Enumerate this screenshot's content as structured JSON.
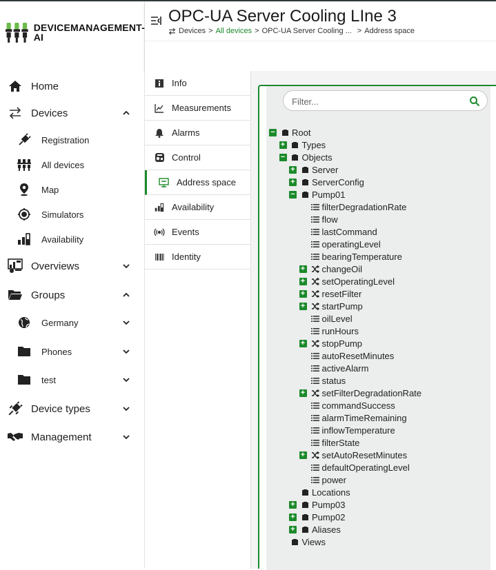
{
  "brand": {
    "name_line1": "DEVICEMANAGEMENT-",
    "name_line2": "AI"
  },
  "sidebar": {
    "items": [
      {
        "label": "Home",
        "icon": "home-icon"
      },
      {
        "label": "Devices",
        "icon": "swap-arrows-icon",
        "expanded": true
      },
      {
        "label": "Registration",
        "icon": "plug-icon"
      },
      {
        "label": "All devices",
        "icon": "devices-icon"
      },
      {
        "label": "Map",
        "icon": "map-pin-icon"
      },
      {
        "label": "Simulators",
        "icon": "simulator-icon"
      },
      {
        "label": "Availability",
        "icon": "availability-icon"
      },
      {
        "label": "Overviews",
        "icon": "dashboard-icon",
        "expanded": false
      },
      {
        "label": "Groups",
        "icon": "folder-open-icon",
        "expanded": true
      },
      {
        "label": "Germany",
        "icon": "globe-icon"
      },
      {
        "label": "Phones",
        "icon": "folder-icon"
      },
      {
        "label": "test",
        "icon": "folder-icon"
      },
      {
        "label": "Device types",
        "icon": "plug-icon",
        "expanded": false
      },
      {
        "label": "Management",
        "icon": "handshake-icon",
        "expanded": false
      }
    ]
  },
  "header": {
    "title": "OPC-UA Server Cooling LIne 3",
    "breadcrumb": [
      "Devices",
      "All devices",
      "OPC-UA Server Cooling ...",
      "Address space"
    ]
  },
  "tabs": [
    {
      "label": "Info"
    },
    {
      "label": "Measurements"
    },
    {
      "label": "Alarms"
    },
    {
      "label": "Control"
    },
    {
      "label": "Address space",
      "active": true
    },
    {
      "label": "Availability"
    },
    {
      "label": "Events"
    },
    {
      "label": "Identity"
    }
  ],
  "filter": {
    "placeholder": "Filter..."
  },
  "tree": [
    {
      "label": "Root",
      "toggle": "−",
      "type": "object"
    },
    {
      "label": "Types",
      "toggle": "+",
      "type": "object"
    },
    {
      "label": "Objects",
      "toggle": "−",
      "type": "object"
    },
    {
      "label": "Server",
      "toggle": "+",
      "type": "object"
    },
    {
      "label": "ServerConfig",
      "toggle": "+",
      "type": "object"
    },
    {
      "label": "Pump01",
      "toggle": "−",
      "type": "object"
    },
    {
      "label": "filterDegradationRate",
      "toggle": "",
      "type": "variable"
    },
    {
      "label": "flow",
      "toggle": "",
      "type": "variable"
    },
    {
      "label": "lastCommand",
      "toggle": "",
      "type": "variable"
    },
    {
      "label": "operatingLevel",
      "toggle": "",
      "type": "variable"
    },
    {
      "label": "bearingTemperature",
      "toggle": "",
      "type": "variable"
    },
    {
      "label": "changeOil",
      "toggle": "+",
      "type": "method"
    },
    {
      "label": "setOperatingLevel",
      "toggle": "+",
      "type": "method"
    },
    {
      "label": "resetFilter",
      "toggle": "+",
      "type": "method"
    },
    {
      "label": "startPump",
      "toggle": "+",
      "type": "method"
    },
    {
      "label": "oilLevel",
      "toggle": "",
      "type": "variable"
    },
    {
      "label": "runHours",
      "toggle": "",
      "type": "variable"
    },
    {
      "label": "stopPump",
      "toggle": "+",
      "type": "method"
    },
    {
      "label": "autoResetMinutes",
      "toggle": "",
      "type": "variable"
    },
    {
      "label": "activeAlarm",
      "toggle": "",
      "type": "variable"
    },
    {
      "label": "status",
      "toggle": "",
      "type": "variable"
    },
    {
      "label": "setFilterDegradationRate",
      "toggle": "+",
      "type": "method"
    },
    {
      "label": "commandSuccess",
      "toggle": "",
      "type": "variable"
    },
    {
      "label": "alarmTimeRemaining",
      "toggle": "",
      "type": "variable"
    },
    {
      "label": "inflowTemperature",
      "toggle": "",
      "type": "variable"
    },
    {
      "label": "filterState",
      "toggle": "",
      "type": "variable"
    },
    {
      "label": "setAutoResetMinutes",
      "toggle": "+",
      "type": "method"
    },
    {
      "label": "defaultOperatingLevel",
      "toggle": "",
      "type": "variable"
    },
    {
      "label": "power",
      "toggle": "",
      "type": "variable"
    },
    {
      "label": "Locations",
      "toggle": "",
      "type": "object"
    },
    {
      "label": "Pump03",
      "toggle": "+",
      "type": "object"
    },
    {
      "label": "Pump02",
      "toggle": "+",
      "type": "object"
    },
    {
      "label": "Aliases",
      "toggle": "+",
      "type": "object"
    },
    {
      "label": "Views",
      "toggle": "",
      "type": "object"
    }
  ],
  "colors": {
    "accent": "#1b8a2a",
    "tree_bg": "#eceded"
  }
}
